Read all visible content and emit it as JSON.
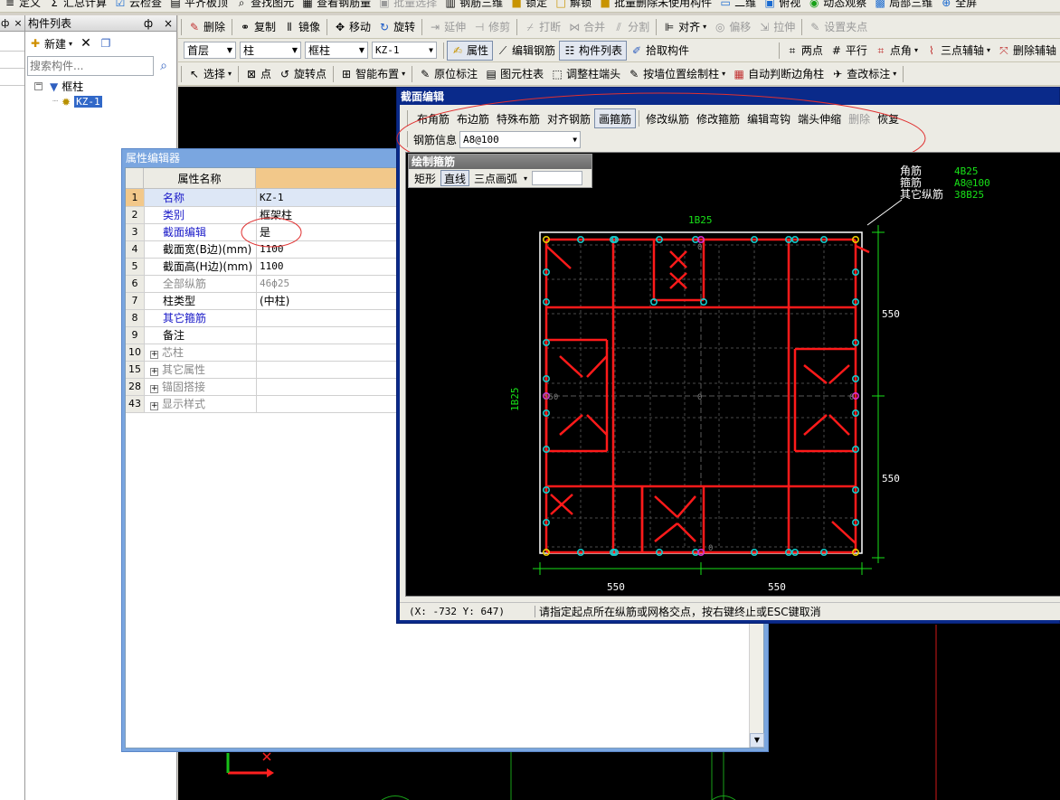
{
  "toolbar_top": {
    "items": [
      "定义",
      "汇总计算",
      "云检查",
      "平齐板顶",
      "查找图元",
      "查看钢筋量",
      "批量选择",
      "钢筋三维",
      "锁定",
      "解锁",
      "批量删除未使用构件",
      "二维",
      "俯视",
      "动态观察",
      "局部三维",
      "全屏"
    ]
  },
  "toolbar_edit": {
    "items": [
      "删除",
      "复制",
      "镜像",
      "移动",
      "旋转",
      "延伸",
      "修剪",
      "打断",
      "合并",
      "分割",
      "对齐",
      "偏移",
      "拉伸",
      "设置夹点"
    ]
  },
  "toolbar_props": {
    "floor": "首层",
    "type": "柱",
    "subtype": "框柱",
    "name": "KZ-1",
    "buttons": [
      "属性",
      "编辑钢筋",
      "构件列表",
      "拾取构件"
    ],
    "right_buttons": [
      "两点",
      "平行",
      "点角",
      "三点辅轴",
      "删除辅轴"
    ]
  },
  "toolbar_draw": {
    "items": [
      "选择",
      "点",
      "旋转点",
      "智能布置",
      "原位标注",
      "图元柱表",
      "调整柱端头",
      "按墙位置绘制柱",
      "自动判断边角柱",
      "查改标注"
    ]
  },
  "component_list": {
    "title": "构件列表",
    "pin": "ф",
    "close": "×",
    "new_label": "新建",
    "search_placeholder": "搜索构件...",
    "tree_root": "框柱",
    "tree_child": "KZ-1"
  },
  "left_strip": {
    "pin": "ф",
    "close": "×"
  },
  "property_editor": {
    "title": "属性编辑器",
    "col_header": "属性名称",
    "rows": [
      {
        "num": "1",
        "name": "名称",
        "value": "KZ-1"
      },
      {
        "num": "2",
        "name": "类别",
        "value": "框架柱"
      },
      {
        "num": "3",
        "name": "截面编辑",
        "value": "是"
      },
      {
        "num": "4",
        "name": "截面宽(B边)(mm)",
        "value": "1100"
      },
      {
        "num": "5",
        "name": "截面高(H边)(mm)",
        "value": "1100"
      },
      {
        "num": "6",
        "name": "全部纵筋",
        "value": "46ф25"
      },
      {
        "num": "7",
        "name": "柱类型",
        "value": "(中柱)"
      },
      {
        "num": "8",
        "name": "其它箍筋",
        "value": ""
      },
      {
        "num": "9",
        "name": "备注",
        "value": ""
      },
      {
        "num": "10",
        "name": "芯柱",
        "value": ""
      },
      {
        "num": "15",
        "name": "其它属性",
        "value": ""
      },
      {
        "num": "28",
        "name": "锚固搭接",
        "value": ""
      },
      {
        "num": "43",
        "name": "显示样式",
        "value": ""
      }
    ]
  },
  "section_editor": {
    "title": "截面编辑",
    "tools": [
      "布角筋",
      "布边筋",
      "特殊布筋",
      "对齐钢筋",
      "画箍筋",
      "修改纵筋",
      "修改箍筋",
      "编辑弯钩",
      "端头伸缩",
      "删除",
      "恢复"
    ],
    "rebar_info_label": "钢筋信息",
    "rebar_info_value": "A8@100",
    "draw_stirrup": {
      "title": "绘制箍筋",
      "options": [
        "矩形",
        "直线",
        "三点画弧"
      ]
    },
    "info": {
      "corner_label": "角筋",
      "corner_value": "4B25",
      "stirrup_label": "箍筋",
      "stirrup_value": "A8@100",
      "other_label": "其它纵筋",
      "other_value": "38B25"
    },
    "top_label": "1B25",
    "left_label": "1B25",
    "dims": {
      "right_top": "550",
      "right_bottom": "550",
      "bottom_left": "550",
      "bottom_right": "550"
    },
    "center_marks": {
      "left": "550",
      "center": "0",
      "right": "0",
      "top": "0",
      "bottom": "0"
    },
    "status_coords": "(X: -732 Y: 647)",
    "status_message": "请指定起点所在纵筋或网格交点，按右键终止或ESC键取消"
  },
  "colors": {
    "rebar": "#ff1a1a",
    "bar_dot": "#14c8c8",
    "corner_dot": "#e6c800",
    "dim_green": "#18e018",
    "window_blue": "#0a2a8a",
    "prop_title": "#7aa6e0"
  }
}
